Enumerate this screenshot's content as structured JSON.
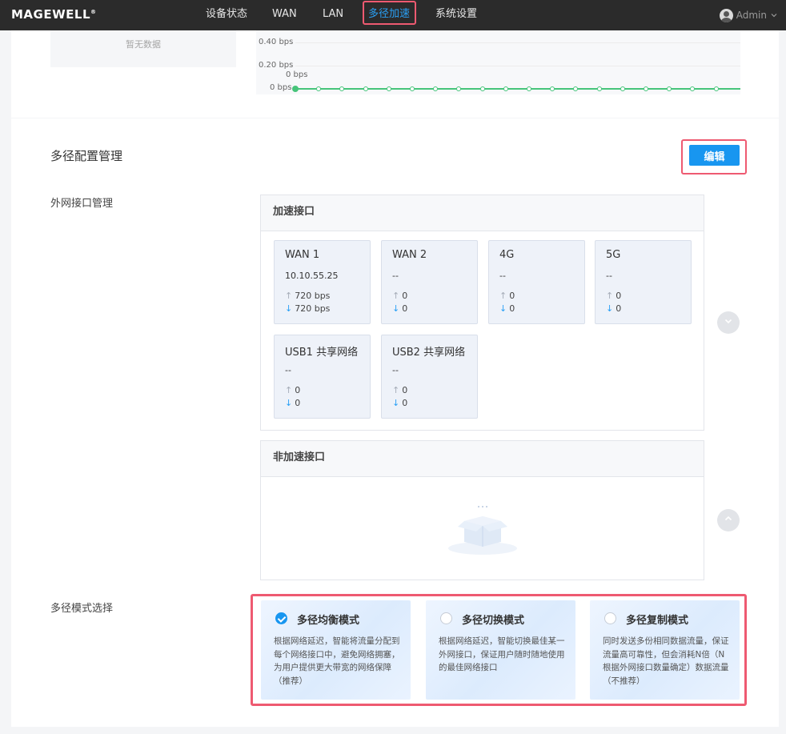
{
  "brand": {
    "logo": "MAGEWELL",
    "mark": "®"
  },
  "nav": {
    "items": [
      {
        "label": "设备状态"
      },
      {
        "label": "WAN"
      },
      {
        "label": "LAN"
      },
      {
        "label": "多径加速"
      },
      {
        "label": "系统设置"
      }
    ],
    "active": "多径加速",
    "user": "Admin"
  },
  "stats": {
    "nodata": "暂无数据",
    "yticks": [
      "0.40 bps",
      "0.20 bps",
      "0 bps"
    ],
    "current_label": "0 bps"
  },
  "config": {
    "title": "多径配置管理",
    "edit_label": "编辑",
    "wan_label": "外网接口管理",
    "accel_title": "加速接口",
    "nonaccel_title": "非加速接口",
    "interfaces": [
      {
        "name": "WAN 1",
        "ip": "10.10.55.25",
        "up": "720 bps",
        "down": "720 bps"
      },
      {
        "name": "WAN 2",
        "ip": "--",
        "up": "0",
        "down": "0"
      },
      {
        "name": "4G",
        "ip": "--",
        "up": "0",
        "down": "0"
      },
      {
        "name": "5G",
        "ip": "--",
        "up": "0",
        "down": "0"
      },
      {
        "name": "USB1 共享网络",
        "ip": "--",
        "up": "0",
        "down": "0"
      },
      {
        "name": "USB2 共享网络",
        "ip": "--",
        "up": "0",
        "down": "0"
      }
    ]
  },
  "modes": {
    "label": "多径模式选择",
    "selected": 0,
    "items": [
      {
        "title": "多径均衡模式",
        "desc": "根据网络延迟，智能将流量分配到每个网络接口中，避免网络拥塞，为用户提供更大带宽的网络保障（推荐）"
      },
      {
        "title": "多径切换模式",
        "desc": "根据网络延迟，智能切换最佳某一外网接口，保证用户随时随地使用的最佳网络接口"
      },
      {
        "title": "多径复制模式",
        "desc": "同时发送多份相同数据流量，保证流量高可靠性，但会消耗N倍（N根据外网接口数量确定）数据流量（不推荐）"
      }
    ]
  },
  "colors": {
    "accent": "#1896f0",
    "highlight": "#ee5a71",
    "series": "#46c47a"
  }
}
